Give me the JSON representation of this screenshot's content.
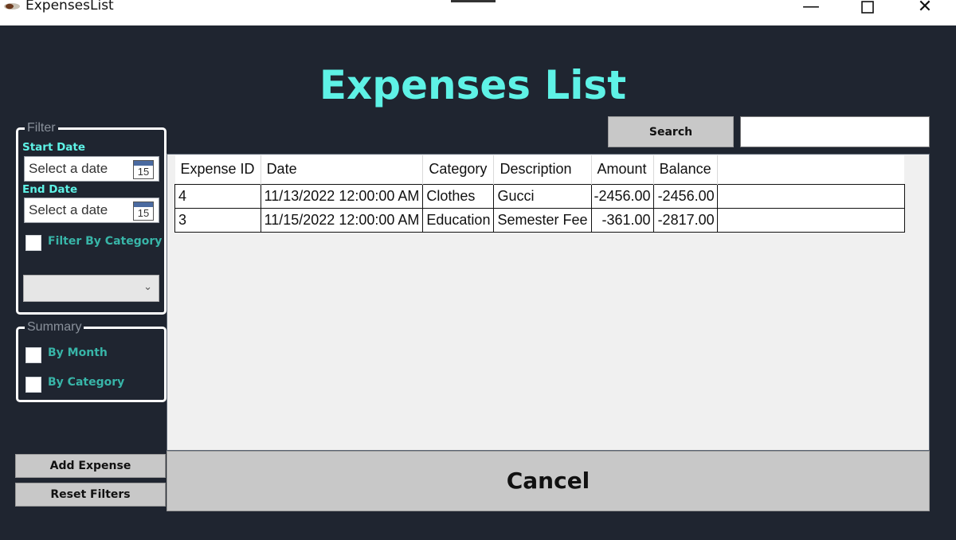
{
  "window": {
    "title": "ExpensesList",
    "minimize_glyph": "—",
    "close_glyph": "✕"
  },
  "heading": "Expenses List",
  "filter": {
    "legend": "Filter",
    "start_date_label": "Start Date",
    "start_date_placeholder": "Select a date",
    "end_date_label": "End Date",
    "end_date_placeholder": "Select a date",
    "calendar_day": "15",
    "filter_by_category_label": "Filter By Category",
    "filter_by_category_checked": false,
    "category_select_value": ""
  },
  "summary": {
    "legend": "Summary",
    "by_month_label": "By Month",
    "by_month_checked": false,
    "by_category_label": "By Category",
    "by_category_checked": false
  },
  "search": {
    "button_label": "Search",
    "input_value": ""
  },
  "table": {
    "columns": [
      "Expense ID",
      "Date",
      "Category",
      "Description",
      "Amount",
      "Balance"
    ],
    "rows": [
      [
        "4",
        "11/13/2022 12:00:00 AM",
        "Clothes",
        "Gucci",
        "-2456.00",
        "-2456.00"
      ],
      [
        "3",
        "11/15/2022 12:00:00 AM",
        "Education",
        "Semester Fee",
        "-361.00",
        "-2817.00"
      ]
    ]
  },
  "buttons": {
    "add_expense": "Add Expense",
    "reset_filters": "Reset Filters",
    "cancel": "Cancel"
  },
  "colors": {
    "background": "#1f2530",
    "heading": "#5ef2e6",
    "field_label": "#5ef2e6",
    "checkbox_label": "#38b5a8",
    "button": "#c8c8c8"
  },
  "icons": {
    "app": "app-icon",
    "calendar": "calendar-icon",
    "dropdown": "chevron-down-icon",
    "minimize": "minimize-icon",
    "maximize": "maximize-icon",
    "close": "close-icon"
  }
}
